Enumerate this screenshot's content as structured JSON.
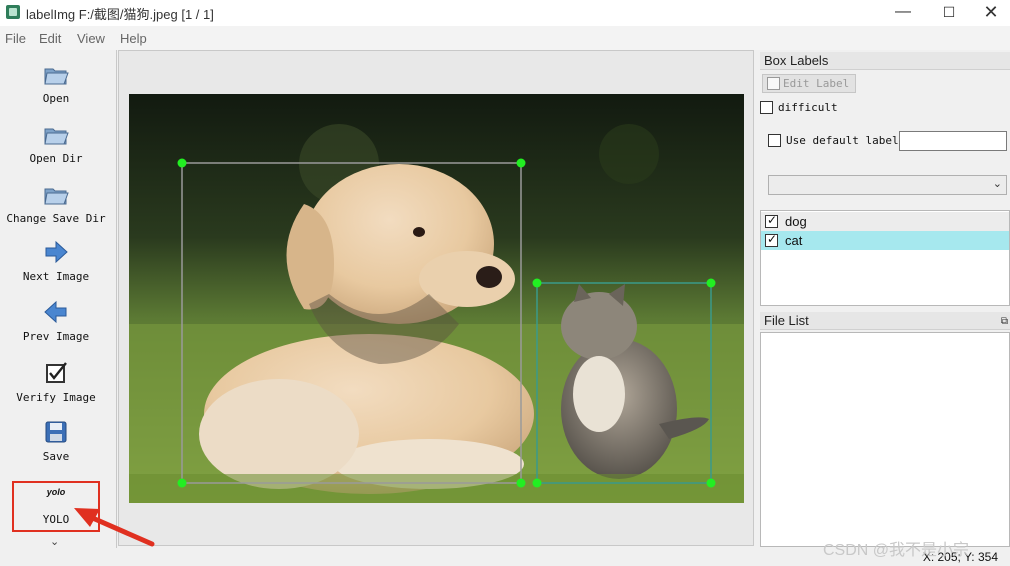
{
  "window": {
    "title": "labelImg F:/截图/猫狗.jpeg [1 / 1]",
    "min_glyph": "—",
    "max_glyph": "☐",
    "close_glyph": "✕"
  },
  "menu": [
    "File",
    "Edit",
    "View",
    "Help"
  ],
  "toolbar": {
    "open": "Open",
    "open_dir": "Open Dir",
    "change_save_dir": "Change Save Dir",
    "next_image": "Next Image",
    "prev_image": "Prev Image",
    "verify_image": "Verify Image",
    "save": "Save",
    "yolo_icon_text": "yolo",
    "yolo": "YOLO",
    "more_glyph": "⌄"
  },
  "box_labels": {
    "title": "Box Labels",
    "edit_label": "Edit Label",
    "difficult": "difficult",
    "use_default_label": "Use default label",
    "default_label_value": "",
    "combo_value": "",
    "labels": [
      {
        "name": "dog",
        "checked": true,
        "selected": false
      },
      {
        "name": "cat",
        "checked": true,
        "selected": true
      }
    ]
  },
  "file_list": {
    "title": "File List",
    "float_glyph": "⧉"
  },
  "status": {
    "coords": "X: 205; Y: 354"
  },
  "watermark": "CSDN @我不是小宗",
  "colors": {
    "dog_box": "#9a9a9a",
    "cat_box": "#3a9a8a",
    "vertex": "#22ee22",
    "selected_row": "#a6e8ee",
    "annotation_red": "#e03020"
  }
}
